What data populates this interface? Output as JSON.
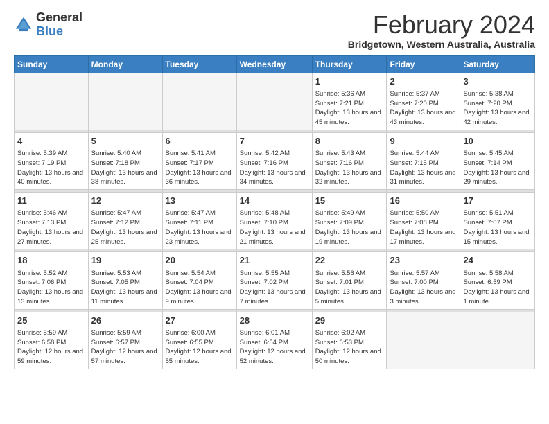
{
  "logo": {
    "general": "General",
    "blue": "Blue"
  },
  "header": {
    "month_year": "February 2024",
    "location": "Bridgetown, Western Australia, Australia"
  },
  "weekdays": [
    "Sunday",
    "Monday",
    "Tuesday",
    "Wednesday",
    "Thursday",
    "Friday",
    "Saturday"
  ],
  "weeks": [
    [
      {
        "day": "",
        "sunrise": "",
        "sunset": "",
        "daylight": "",
        "empty": true
      },
      {
        "day": "",
        "sunrise": "",
        "sunset": "",
        "daylight": "",
        "empty": true
      },
      {
        "day": "",
        "sunrise": "",
        "sunset": "",
        "daylight": "",
        "empty": true
      },
      {
        "day": "",
        "sunrise": "",
        "sunset": "",
        "daylight": "",
        "empty": true
      },
      {
        "day": "1",
        "sunrise": "Sunrise: 5:36 AM",
        "sunset": "Sunset: 7:21 PM",
        "daylight": "Daylight: 13 hours and 45 minutes.",
        "empty": false
      },
      {
        "day": "2",
        "sunrise": "Sunrise: 5:37 AM",
        "sunset": "Sunset: 7:20 PM",
        "daylight": "Daylight: 13 hours and 43 minutes.",
        "empty": false
      },
      {
        "day": "3",
        "sunrise": "Sunrise: 5:38 AM",
        "sunset": "Sunset: 7:20 PM",
        "daylight": "Daylight: 13 hours and 42 minutes.",
        "empty": false
      }
    ],
    [
      {
        "day": "4",
        "sunrise": "Sunrise: 5:39 AM",
        "sunset": "Sunset: 7:19 PM",
        "daylight": "Daylight: 13 hours and 40 minutes.",
        "empty": false
      },
      {
        "day": "5",
        "sunrise": "Sunrise: 5:40 AM",
        "sunset": "Sunset: 7:18 PM",
        "daylight": "Daylight: 13 hours and 38 minutes.",
        "empty": false
      },
      {
        "day": "6",
        "sunrise": "Sunrise: 5:41 AM",
        "sunset": "Sunset: 7:17 PM",
        "daylight": "Daylight: 13 hours and 36 minutes.",
        "empty": false
      },
      {
        "day": "7",
        "sunrise": "Sunrise: 5:42 AM",
        "sunset": "Sunset: 7:16 PM",
        "daylight": "Daylight: 13 hours and 34 minutes.",
        "empty": false
      },
      {
        "day": "8",
        "sunrise": "Sunrise: 5:43 AM",
        "sunset": "Sunset: 7:16 PM",
        "daylight": "Daylight: 13 hours and 32 minutes.",
        "empty": false
      },
      {
        "day": "9",
        "sunrise": "Sunrise: 5:44 AM",
        "sunset": "Sunset: 7:15 PM",
        "daylight": "Daylight: 13 hours and 31 minutes.",
        "empty": false
      },
      {
        "day": "10",
        "sunrise": "Sunrise: 5:45 AM",
        "sunset": "Sunset: 7:14 PM",
        "daylight": "Daylight: 13 hours and 29 minutes.",
        "empty": false
      }
    ],
    [
      {
        "day": "11",
        "sunrise": "Sunrise: 5:46 AM",
        "sunset": "Sunset: 7:13 PM",
        "daylight": "Daylight: 13 hours and 27 minutes.",
        "empty": false
      },
      {
        "day": "12",
        "sunrise": "Sunrise: 5:47 AM",
        "sunset": "Sunset: 7:12 PM",
        "daylight": "Daylight: 13 hours and 25 minutes.",
        "empty": false
      },
      {
        "day": "13",
        "sunrise": "Sunrise: 5:47 AM",
        "sunset": "Sunset: 7:11 PM",
        "daylight": "Daylight: 13 hours and 23 minutes.",
        "empty": false
      },
      {
        "day": "14",
        "sunrise": "Sunrise: 5:48 AM",
        "sunset": "Sunset: 7:10 PM",
        "daylight": "Daylight: 13 hours and 21 minutes.",
        "empty": false
      },
      {
        "day": "15",
        "sunrise": "Sunrise: 5:49 AM",
        "sunset": "Sunset: 7:09 PM",
        "daylight": "Daylight: 13 hours and 19 minutes.",
        "empty": false
      },
      {
        "day": "16",
        "sunrise": "Sunrise: 5:50 AM",
        "sunset": "Sunset: 7:08 PM",
        "daylight": "Daylight: 13 hours and 17 minutes.",
        "empty": false
      },
      {
        "day": "17",
        "sunrise": "Sunrise: 5:51 AM",
        "sunset": "Sunset: 7:07 PM",
        "daylight": "Daylight: 13 hours and 15 minutes.",
        "empty": false
      }
    ],
    [
      {
        "day": "18",
        "sunrise": "Sunrise: 5:52 AM",
        "sunset": "Sunset: 7:06 PM",
        "daylight": "Daylight: 13 hours and 13 minutes.",
        "empty": false
      },
      {
        "day": "19",
        "sunrise": "Sunrise: 5:53 AM",
        "sunset": "Sunset: 7:05 PM",
        "daylight": "Daylight: 13 hours and 11 minutes.",
        "empty": false
      },
      {
        "day": "20",
        "sunrise": "Sunrise: 5:54 AM",
        "sunset": "Sunset: 7:04 PM",
        "daylight": "Daylight: 13 hours and 9 minutes.",
        "empty": false
      },
      {
        "day": "21",
        "sunrise": "Sunrise: 5:55 AM",
        "sunset": "Sunset: 7:02 PM",
        "daylight": "Daylight: 13 hours and 7 minutes.",
        "empty": false
      },
      {
        "day": "22",
        "sunrise": "Sunrise: 5:56 AM",
        "sunset": "Sunset: 7:01 PM",
        "daylight": "Daylight: 13 hours and 5 minutes.",
        "empty": false
      },
      {
        "day": "23",
        "sunrise": "Sunrise: 5:57 AM",
        "sunset": "Sunset: 7:00 PM",
        "daylight": "Daylight: 13 hours and 3 minutes.",
        "empty": false
      },
      {
        "day": "24",
        "sunrise": "Sunrise: 5:58 AM",
        "sunset": "Sunset: 6:59 PM",
        "daylight": "Daylight: 13 hours and 1 minute.",
        "empty": false
      }
    ],
    [
      {
        "day": "25",
        "sunrise": "Sunrise: 5:59 AM",
        "sunset": "Sunset: 6:58 PM",
        "daylight": "Daylight: 12 hours and 59 minutes.",
        "empty": false
      },
      {
        "day": "26",
        "sunrise": "Sunrise: 5:59 AM",
        "sunset": "Sunset: 6:57 PM",
        "daylight": "Daylight: 12 hours and 57 minutes.",
        "empty": false
      },
      {
        "day": "27",
        "sunrise": "Sunrise: 6:00 AM",
        "sunset": "Sunset: 6:55 PM",
        "daylight": "Daylight: 12 hours and 55 minutes.",
        "empty": false
      },
      {
        "day": "28",
        "sunrise": "Sunrise: 6:01 AM",
        "sunset": "Sunset: 6:54 PM",
        "daylight": "Daylight: 12 hours and 52 minutes.",
        "empty": false
      },
      {
        "day": "29",
        "sunrise": "Sunrise: 6:02 AM",
        "sunset": "Sunset: 6:53 PM",
        "daylight": "Daylight: 12 hours and 50 minutes.",
        "empty": false
      },
      {
        "day": "",
        "sunrise": "",
        "sunset": "",
        "daylight": "",
        "empty": true
      },
      {
        "day": "",
        "sunrise": "",
        "sunset": "",
        "daylight": "",
        "empty": true
      }
    ]
  ]
}
